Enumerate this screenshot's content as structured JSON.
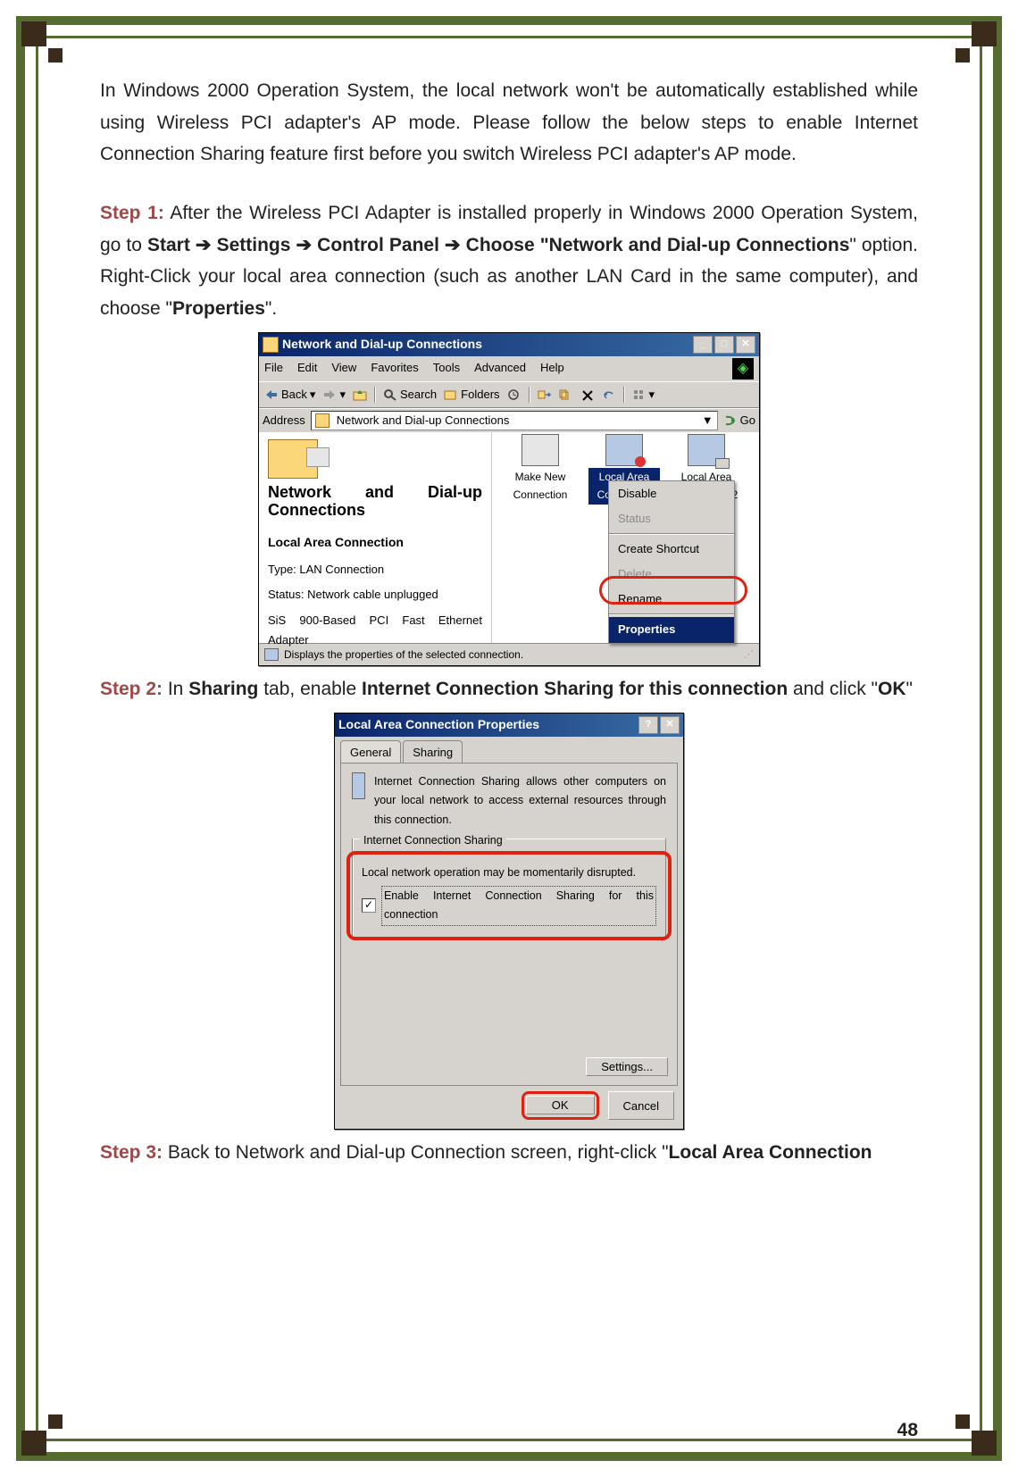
{
  "page_number": "48",
  "intro": "In Windows 2000 Operation System, the local network won't be automatically established while using Wireless PCI adapter's AP mode. Please follow the below steps to enable Internet Connection Sharing feature first before you switch Wireless PCI adapter's AP mode.",
  "step1": {
    "label": "Step 1:",
    "t1": " After the Wireless PCI Adapter is installed properly in Windows 2000 Operation System, go to ",
    "b1": "Start",
    "b2": "Settings",
    "b3": "Control Panel",
    "b4": "Choose \"Network and Dial-up Connections",
    "t2": "\" option. Right-Click your local area connection (such as another LAN Card in the same computer), and choose \"",
    "b5": "Properties",
    "t3": "\"."
  },
  "step2": {
    "label": "Step 2:",
    "t1": " In ",
    "b1": "Sharing",
    "t2": " tab, enable ",
    "b2": "Internet Connection Sharing for this connection",
    "t3": " and click \"",
    "b3": "OK",
    "t4": "\""
  },
  "step3": {
    "label": "Step 3:",
    "t1": " Back to Network and Dial-up Connection screen, right-click \"",
    "b1": "Local Area Connection"
  },
  "explorer": {
    "title": "Network and Dial-up Connections",
    "menu": {
      "file": "File",
      "edit": "Edit",
      "view": "View",
      "favorites": "Favorites",
      "tools": "Tools",
      "advanced": "Advanced",
      "help": "Help"
    },
    "toolbar": {
      "back": "Back",
      "search": "Search",
      "folders": "Folders"
    },
    "address_label": "Address",
    "address_value": "Network and Dial-up Connections",
    "go_label": "Go",
    "left": {
      "title": "Network and Dial-up Connections",
      "heading": "Local Area Connection",
      "type": "Type: LAN Connection",
      "status": "Status: Network cable unplugged",
      "adapter": "SiS 900-Based PCI Fast Ethernet Adapter"
    },
    "icons": {
      "make_new": "Make New Connection",
      "lac": "Local Area Connection",
      "lac2": "Local Area Connection 2"
    },
    "context": {
      "disable": "Disable",
      "status": "Status",
      "shortcut": "Create Shortcut",
      "delete": "Delete",
      "rename": "Rename",
      "properties": "Properties"
    },
    "status_text": "Displays the properties of the selected connection."
  },
  "props": {
    "title": "Local Area Connection Properties",
    "tab_general": "General",
    "tab_sharing": "Sharing",
    "desc": "Internet Connection Sharing allows other computers on your local network to access external resources through this connection.",
    "group_title": "Internet Connection Sharing",
    "group_line": "Local network operation may be momentarily disrupted.",
    "checkbox": "Enable Internet Connection Sharing for this connection",
    "settings_btn": "Settings...",
    "ok_btn": "OK",
    "cancel_btn": "Cancel"
  }
}
